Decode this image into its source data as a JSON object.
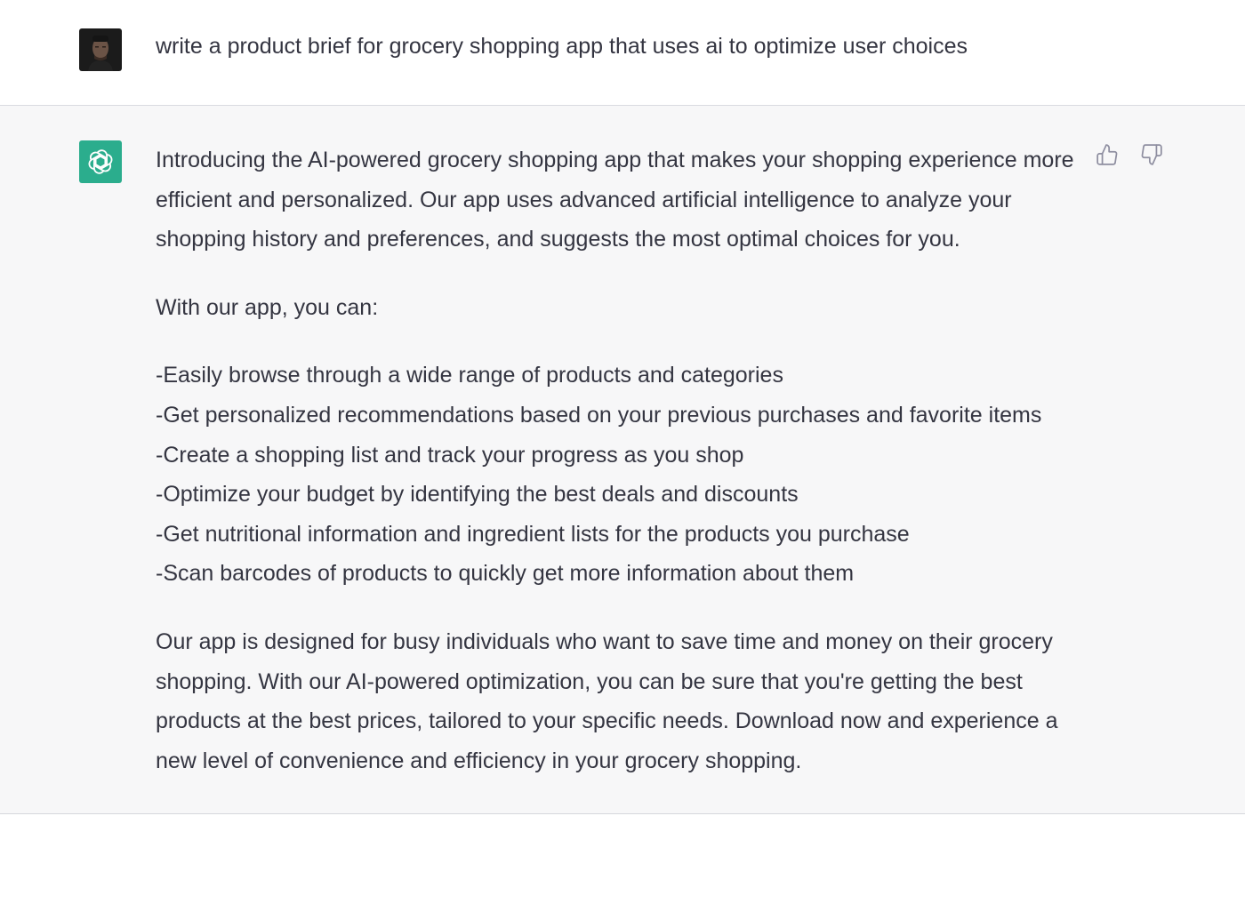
{
  "conversation": {
    "user_message": "write a product brief for grocery shopping app that uses ai to optimize user choices",
    "assistant": {
      "intro": "Introducing the AI-powered grocery shopping app that makes your shopping experience more efficient and personalized. Our app uses advanced artificial intelligence to analyze your shopping history and preferences, and suggests the most optimal choices for you.",
      "list_heading": "With our app, you can:",
      "list_items": [
        "-Easily browse through a wide range of products and categories",
        "-Get personalized recommendations based on your previous purchases and favorite items",
        "-Create a shopping list and track your progress as you shop",
        "-Optimize your budget by identifying the best deals and discounts",
        "-Get nutritional information and ingredient lists for the products you purchase",
        "-Scan barcodes of products to quickly get more information about them"
      ],
      "closing": "Our app is designed for busy individuals who want to save time and money on their grocery shopping. With our AI-powered optimization, you can be sure that you're getting the best products at the best prices, tailored to your specific needs. Download now and experience a new level of convenience and efficiency in your grocery shopping."
    }
  },
  "icons": {
    "user_avatar": "user-avatar-photo",
    "assistant_avatar": "openai-logo-icon",
    "thumbs_up": "thumbs-up-icon",
    "thumbs_down": "thumbs-down-icon"
  },
  "colors": {
    "assistant_avatar_bg": "#10a37f",
    "assistant_row_bg": "#f7f7f8",
    "text": "#343541"
  }
}
